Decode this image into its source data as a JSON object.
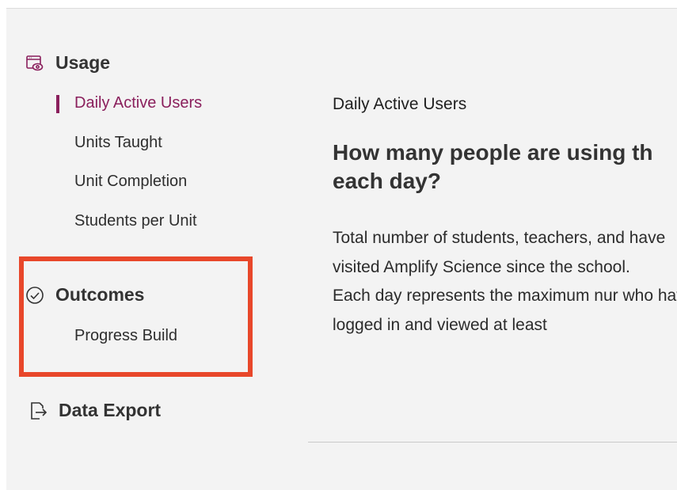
{
  "sidebar": {
    "usage": {
      "title": "Usage",
      "items": [
        {
          "label": "Daily Active Users",
          "active": true
        },
        {
          "label": "Units Taught",
          "active": false
        },
        {
          "label": "Unit Completion",
          "active": false
        },
        {
          "label": "Students per Unit",
          "active": false
        }
      ]
    },
    "outcomes": {
      "title": "Outcomes",
      "items": [
        {
          "label": "Progress Build",
          "active": false
        }
      ]
    },
    "data_export": {
      "title": "Data Export"
    }
  },
  "main": {
    "kicker": "Daily Active Users",
    "heading": "How many people are using th each day?",
    "body": [
      "Total number of students, teachers, and have visited Amplify Science since the school.",
      "Each day represents the maximum nur who have logged in and viewed at least"
    ]
  },
  "colors": {
    "accent": "#8a1f5c",
    "highlight": "#e8472a",
    "background": "#f3f3f3"
  },
  "icons": {
    "usage": "chart-window-eye-icon",
    "outcomes": "check-circle-icon",
    "data_export": "export-icon"
  }
}
